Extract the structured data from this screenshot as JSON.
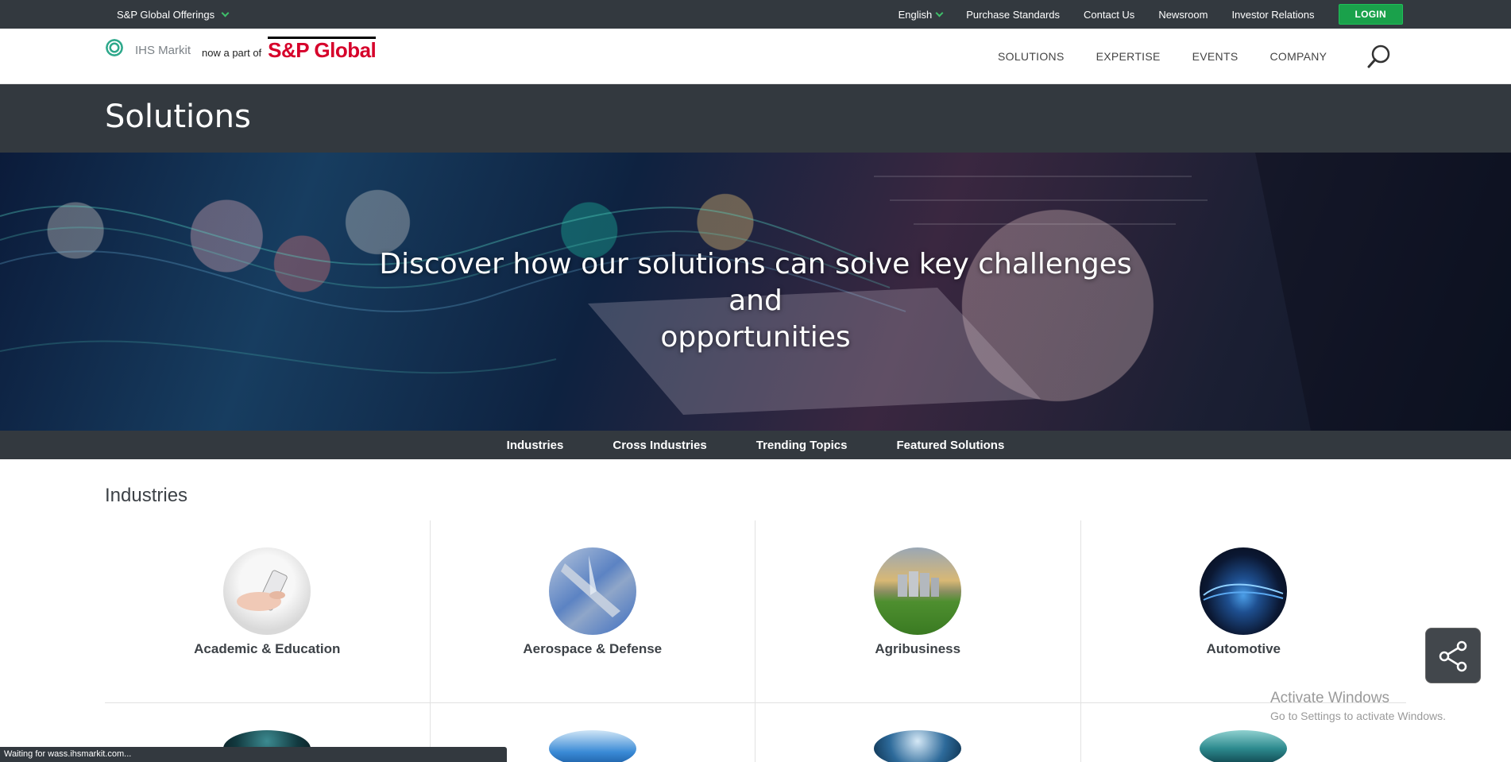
{
  "utility": {
    "offerings": "S&P Global Offerings",
    "language": "English",
    "links": [
      "Purchase Standards",
      "Contact Us",
      "Newsroom",
      "Investor Relations"
    ],
    "login": "LOGIN"
  },
  "header": {
    "ihs_text": "IHS Markit",
    "now_part": "now a part of",
    "sp_global": "S&P Global",
    "nav": [
      "SOLUTIONS",
      "EXPERTISE",
      "EVENTS",
      "COMPANY"
    ]
  },
  "page": {
    "title": "Solutions"
  },
  "hero": {
    "headline_line1": "Discover how our solutions can solve key challenges and",
    "headline_line2": "opportunities"
  },
  "subnav": [
    "Industries",
    "Cross Industries",
    "Trending Topics",
    "Featured Solutions"
  ],
  "industries": {
    "title": "Industries",
    "items": [
      "Academic & Education",
      "Aerospace & Defense",
      "Agribusiness",
      "Automotive"
    ]
  },
  "watermark": {
    "title": "Activate Windows",
    "subtitle": "Go to Settings to activate Windows."
  },
  "status": {
    "text": "Waiting for wass.ihsmarkit.com..."
  },
  "colors": {
    "dark_band": "#33393f",
    "login_green": "#1aa14b",
    "brand_red": "#d6002a",
    "ihs_teal": "#2fa98c"
  }
}
